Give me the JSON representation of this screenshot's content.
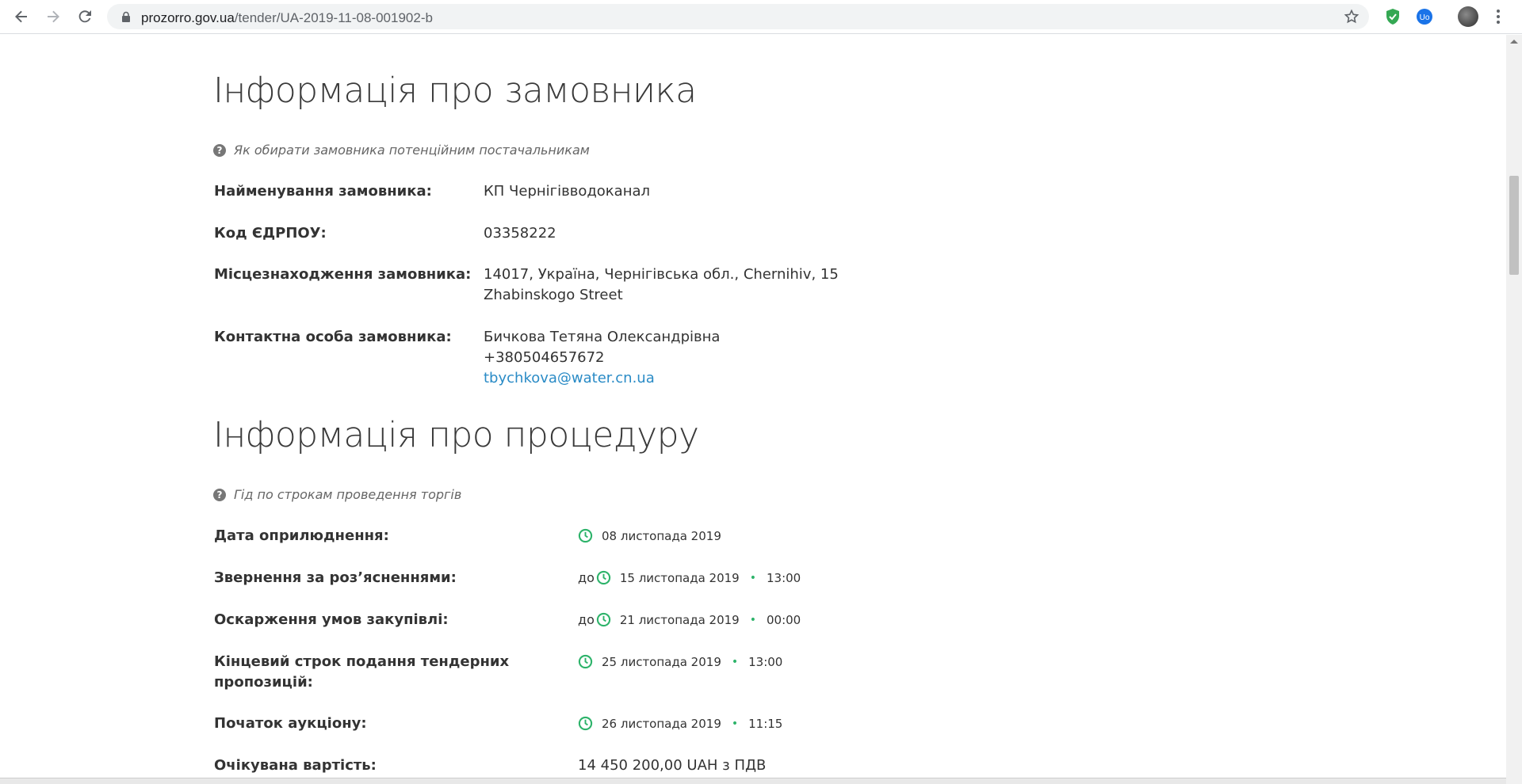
{
  "browser": {
    "url_host": "prozorro.gov.ua",
    "url_path": "/tender/UA-2019-11-08-001902-b",
    "colors": {
      "shield": "#34a853",
      "ext_blue": "#1a73e8"
    }
  },
  "customer": {
    "title": "Інформація про замовника",
    "hint": "Як обирати замовника потенційним постачальникам",
    "fields": {
      "name_label": "Найменування замовника:",
      "name_value": "КП Чернігівводоканал",
      "edrpou_label": "Код ЄДРПОУ:",
      "edrpou_value": "03358222",
      "location_label": "Місцезнаходження замовника:",
      "location_line1": "14017, Україна, Чернігівська обл., Chernihiv, 15",
      "location_line2": "Zhabinskogo Street",
      "contact_label": "Контактна особа замовника:",
      "contact_name": "Бичкова Тетяна Олександрівна",
      "contact_phone": "+380504657672",
      "contact_email": "tbychkova@water.cn.ua"
    }
  },
  "procedure": {
    "title": "Інформація про процедуру",
    "hint": "Гід по строкам проведення торгів",
    "rows": [
      {
        "label": "Дата оприлюднення:",
        "prefix": "",
        "date": "08 листопада 2019",
        "time": ""
      },
      {
        "label": "Звернення за роз’ясненнями:",
        "prefix": "до",
        "date": "15 листопада 2019",
        "time": "13:00"
      },
      {
        "label": "Оскарження умов закупівлі:",
        "prefix": "до",
        "date": "21 листопада 2019",
        "time": "00:00"
      },
      {
        "label": "Кінцевий строк подання тендерних",
        "label2": "пропозицій:",
        "prefix": "",
        "date": "25 листопада 2019",
        "time": "13:00"
      },
      {
        "label": "Початок аукціону:",
        "prefix": "",
        "date": "26 листопада 2019",
        "time": "11:15"
      }
    ],
    "expected_label": "Очікувана вартість:",
    "expected_value": "14 450 200,00 UAH з ПДВ",
    "clock_color": "#2db36a"
  }
}
